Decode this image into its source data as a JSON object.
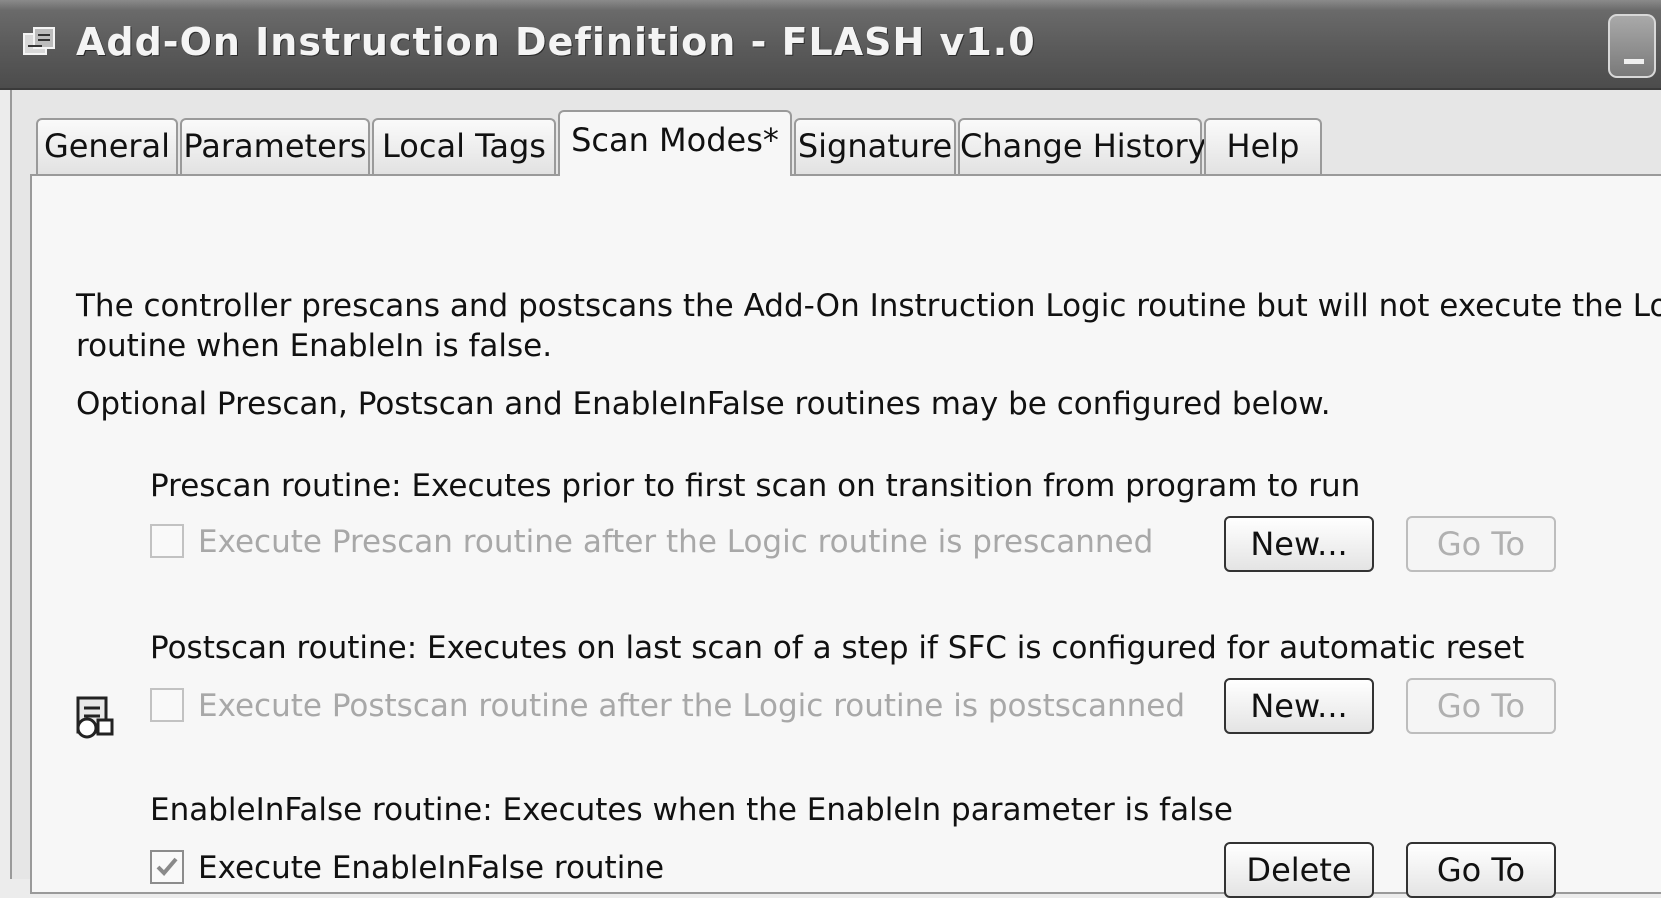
{
  "window": {
    "title": "Add-On Instruction Definition - FLASH v1.0",
    "icon": "aoi-window-icon"
  },
  "tabs": [
    {
      "label": "General",
      "active": false
    },
    {
      "label": "Parameters",
      "active": false
    },
    {
      "label": "Local Tags",
      "active": false
    },
    {
      "label": "Scan Modes*",
      "active": true
    },
    {
      "label": "Signature",
      "active": false
    },
    {
      "label": "Change History",
      "active": false
    },
    {
      "label": "Help",
      "active": false
    }
  ],
  "intro": {
    "line1": "The controller prescans and postscans the Add-On Instruction Logic routine but will not execute the Logic",
    "line2": "routine when EnableIn is false.",
    "optional": "Optional Prescan, Postscan and EnableInFalse routines may be configured below."
  },
  "prescan": {
    "heading": "Prescan routine: Executes prior to first scan on transition from program to run",
    "checkbox_label": "Execute Prescan routine after the Logic routine is prescanned",
    "checked": false,
    "enabled": false,
    "new_label": "New...",
    "goto_label": "Go To"
  },
  "postscan": {
    "heading": "Postscan routine: Executes on last scan of a step if SFC is configured for automatic reset",
    "checkbox_label": "Execute Postscan routine after the Logic routine is postscanned",
    "checked": false,
    "enabled": false,
    "new_label": "New...",
    "goto_label": "Go To"
  },
  "enableinfalse": {
    "icon": "routine-icon",
    "heading": "EnableInFalse routine: Executes when the EnableIn parameter is false",
    "checkbox_label": "Execute EnableInFalse routine",
    "checked": true,
    "enabled": true,
    "delete_label": "Delete",
    "goto_label": "Go To"
  }
}
